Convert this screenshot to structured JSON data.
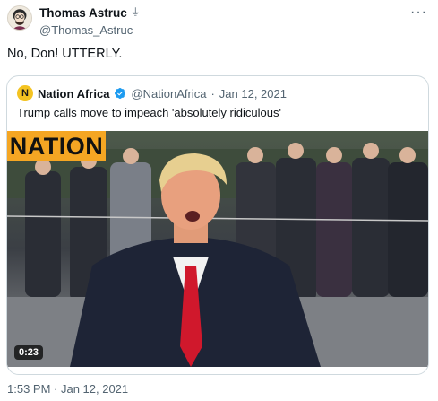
{
  "author": {
    "name": "Thomas Astruc",
    "badge_icon": "automated-account-icon",
    "handle": "@Thomas_Astruc",
    "more_label": "···"
  },
  "tweet": {
    "text": "No, Don! UTTERLY.",
    "timestamp": "1:53 PM · Jan 12, 2021"
  },
  "quoted": {
    "avatar_letter": "N",
    "name": "Nation Africa",
    "verified_icon": "verified-badge-icon",
    "handle": "@NationAfrica",
    "separator": "·",
    "date": "Jan 12, 2021",
    "text": "Trump calls move to impeach 'absolutely ridiculous'",
    "video": {
      "brand_logo_text": "NATION",
      "duration": "0:23",
      "brand_color": "#f5a623"
    }
  },
  "colors": {
    "text_primary": "#0f1419",
    "text_secondary": "#536471",
    "border": "#cfd9de",
    "verified": "#1d9bf0"
  }
}
